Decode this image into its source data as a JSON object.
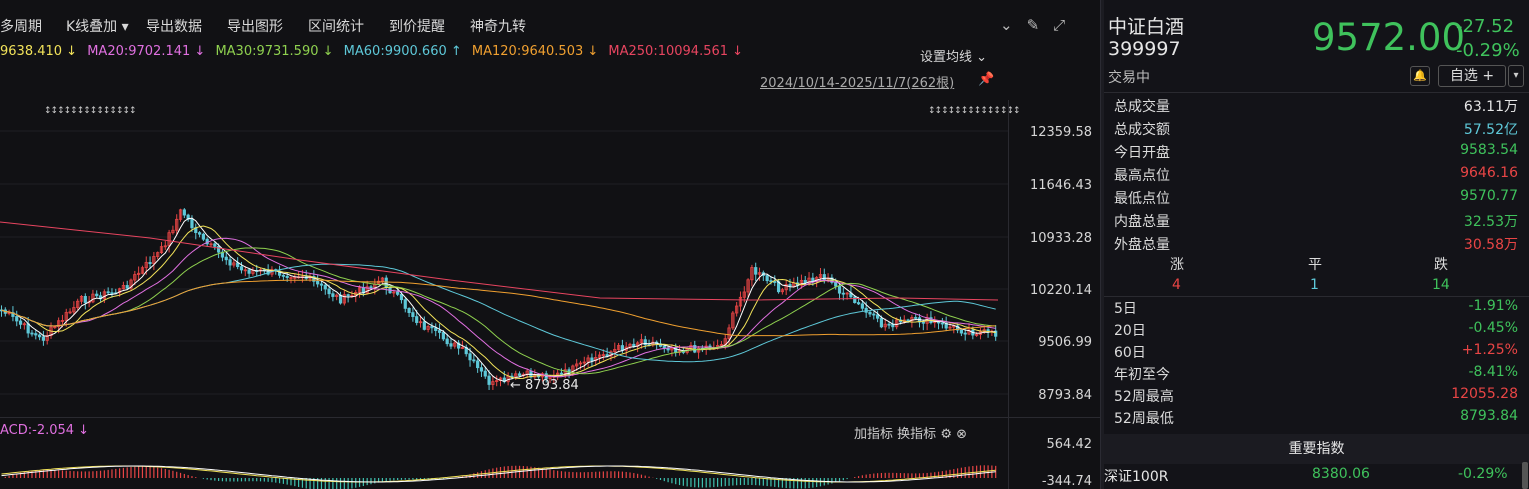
{
  "toolbar": {
    "items": [
      "多周期",
      "K线叠加 ▾",
      "导出数据",
      "导出图形",
      "区间统计",
      "到价提醒",
      "神奇九转"
    ],
    "icons": [
      "chevron-circle-icon",
      "brush-icon",
      "expand-icon"
    ]
  },
  "ma_line": {
    "ma10": "9638.410 ↓",
    "ma20": "MA20:9702.141 ↓",
    "ma30": "MA30:9731.590 ↓",
    "ma60": "MA60:9900.660 ↑",
    "ma120": "MA120:9640.503 ↓",
    "ma250": "MA250:10094.561 ↓",
    "colors": {
      "ma10": "#f2e35a",
      "ma20": "#e070e0",
      "ma30": "#8fd14f",
      "ma60": "#5ec8d8",
      "ma120": "#f0a030",
      "ma250": "#e84560"
    }
  },
  "set_ma": "设置均线 ⌄",
  "date_range": "2024/10/14-2025/11/7(262根)",
  "y_ticks": [
    "12359.58",
    "11646.43",
    "10933.28",
    "10220.14",
    "9506.99",
    "8793.84"
  ],
  "low_annotation": "8793.84",
  "macd": {
    "label": "ACD:-2.054 ↓",
    "add_indicator": "加指标",
    "switch_indicator": "换指标",
    "y_ticks": [
      "564.42",
      "-344.74"
    ]
  },
  "stock": {
    "name": "中证白酒",
    "code": "399997",
    "status": "交易中",
    "price": "9572.00",
    "change": "-27.52",
    "change_pct": "-0.29%",
    "watchlist": "自选 +"
  },
  "quotes": [
    {
      "k": "总成交量",
      "v": "63.11万",
      "color": "w"
    },
    {
      "k": "总成交额",
      "v": "57.52亿",
      "color": "c"
    },
    {
      "k": "今日开盘",
      "v": "9583.54",
      "color": "g"
    },
    {
      "k": "最高点位",
      "v": "9646.16",
      "color": "r"
    },
    {
      "k": "最低点位",
      "v": "9570.77",
      "color": "g"
    },
    {
      "k": "内盘总量",
      "v": "32.53万",
      "color": "g"
    },
    {
      "k": "外盘总量",
      "v": "30.58万",
      "color": "r"
    }
  ],
  "breadth": {
    "labels": [
      "涨",
      "平",
      "跌"
    ],
    "values": [
      "4",
      "1",
      "14"
    ]
  },
  "periods": [
    {
      "k": "5日",
      "v": "-1.91%",
      "color": "g"
    },
    {
      "k": "20日",
      "v": "-0.45%",
      "color": "g"
    },
    {
      "k": "60日",
      "v": "+1.25%",
      "color": "r"
    },
    {
      "k": "年初至今",
      "v": "-8.41%",
      "color": "g"
    },
    {
      "k": "52周最高",
      "v": "12055.28",
      "color": "r"
    },
    {
      "k": "52周最低",
      "v": "8793.84",
      "color": "g"
    }
  ],
  "important_index": {
    "header": "重要指数",
    "rows": [
      {
        "name": "深证100R",
        "value": "8380.06",
        "pct": "-0.29%"
      }
    ]
  }
}
